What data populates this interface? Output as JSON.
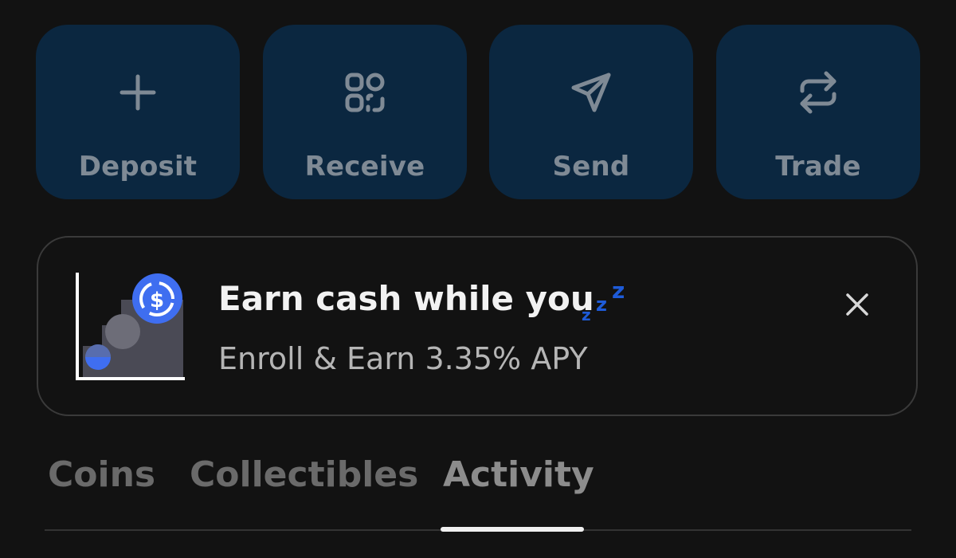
{
  "actions": {
    "deposit": {
      "label": "Deposit",
      "icon": "plus-icon"
    },
    "receive": {
      "label": "Receive",
      "icon": "qr-scan-icon"
    },
    "send": {
      "label": "Send",
      "icon": "paper-plane-icon"
    },
    "trade": {
      "label": "Trade",
      "icon": "swap-arrows-icon"
    }
  },
  "promo": {
    "title": "Earn cash while you",
    "subtitle": "Enroll & Earn 3.35% APY",
    "icon": "usdc-coin-icon",
    "emoji": "zzz-icon",
    "close_icon": "close-icon"
  },
  "tabs": [
    {
      "label": "Coins"
    },
    {
      "label": "Collectibles"
    },
    {
      "label": "Activity",
      "active": true
    }
  ],
  "colors": {
    "background": "#121212",
    "action_bg": "#0b2740",
    "action_text": "#7f8a95",
    "accent_blue": "#3f6ef0",
    "zzz_blue": "#1e5bd8"
  }
}
